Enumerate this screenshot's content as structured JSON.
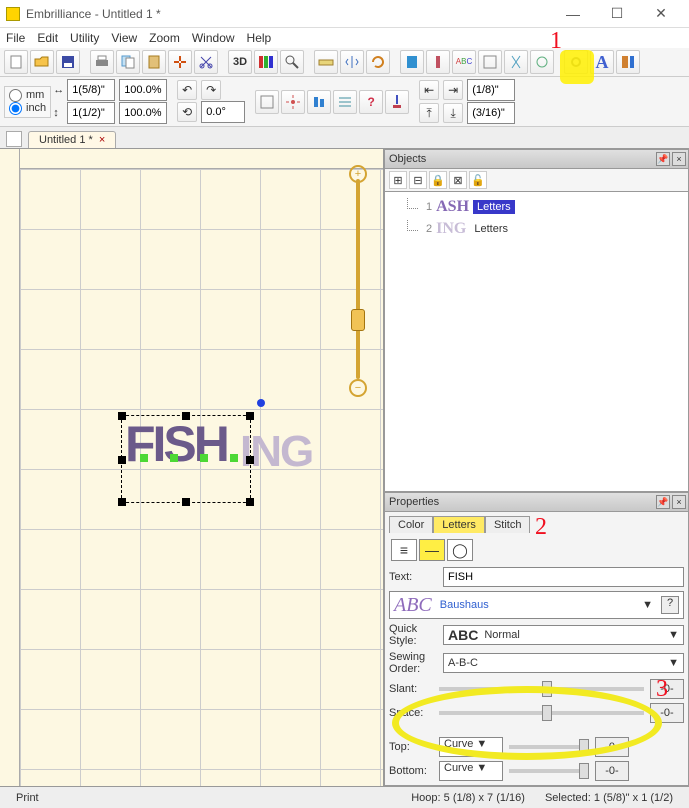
{
  "app": {
    "title": "Embrilliance - Untitled 1 *"
  },
  "menus": [
    "File",
    "Edit",
    "Utility",
    "View",
    "Zoom",
    "Window",
    "Help"
  ],
  "units": {
    "mm": "mm",
    "inch": "inch",
    "selected": "inch"
  },
  "spin": {
    "row1_size": "1(5/8)\"",
    "row2_size": "1(1/2)\"",
    "row1_pct": "100.0%",
    "row2_pct": "100.0%",
    "angle": "0.0°",
    "row1_offset": "(1/8)\"",
    "row2_offset": "(3/16)\""
  },
  "tab": {
    "name": "Untitled 1 *"
  },
  "objects_panel": {
    "title": "Objects",
    "items": [
      {
        "num": "1",
        "icon": "ASH",
        "label": "Letters",
        "selected": true
      },
      {
        "num": "2",
        "icon": "ING",
        "label": "Letters",
        "selected": false
      }
    ]
  },
  "properties_panel": {
    "title": "Properties",
    "tabs": [
      "Color",
      "Letters",
      "Stitch"
    ],
    "active_tab": "Letters",
    "text_label": "Text:",
    "text_value": "FISH",
    "font_name": "Baushaus",
    "quick_style_label": "Quick Style:",
    "quick_style_value": "Normal",
    "sewing_order_label": "Sewing Order:",
    "sewing_order_value": "A-B-C",
    "slant_label": "Slant:",
    "slant_value": "-0-",
    "space_label": "Space:",
    "space_value": "-0-",
    "top_label": "Top:",
    "top_mode": "Curve",
    "top_value": "-0-",
    "bottom_label": "Bottom:",
    "bottom_mode": "Curve",
    "bottom_value": "-0-",
    "abc_preview": "ABC",
    "quick_abc": "ABC"
  },
  "canvas": {
    "word1": "FISH",
    "word2": "ING"
  },
  "status": {
    "left": "Print",
    "hoop": "Hoop: 5 (1/8) x 7 (1/16)",
    "sel": "Selected: 1 (5/8)\" x 1 (1/2)"
  },
  "annotations": {
    "n1": "1",
    "n2": "2",
    "n3": "3"
  }
}
